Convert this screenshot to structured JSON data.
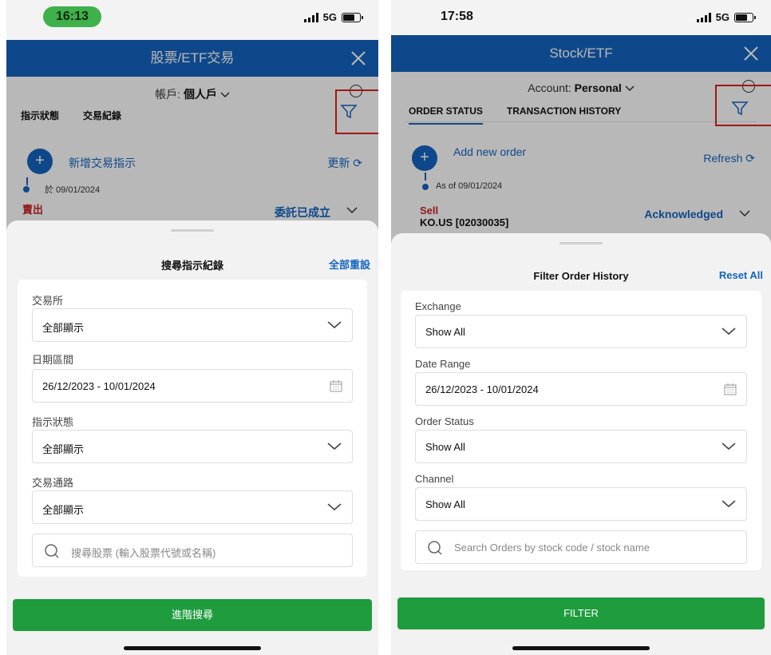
{
  "screens": [
    {
      "status": {
        "time": "16:13",
        "network": "5G"
      },
      "header": {
        "title": "股票/ETF交易"
      },
      "account": {
        "label": "帳戶:",
        "value": "個人戶"
      },
      "tabs": [
        "指示狀態",
        "交易紀錄"
      ],
      "actions": {
        "add": "新增交易指示",
        "refresh": "更新"
      },
      "as_of": "於 09/01/2024",
      "order": {
        "type": "賣出",
        "code": "",
        "status": "委託已成立"
      },
      "sheet": {
        "title": "搜尋指示紀錄",
        "reset": "全部重設",
        "fields": [
          {
            "label": "交易所",
            "value": "全部顯示",
            "kind": "select"
          },
          {
            "label": "日期區間",
            "value": "26/12/2023 - 10/01/2024",
            "kind": "date"
          },
          {
            "label": "指示狀態",
            "value": "全部顯示",
            "kind": "select"
          },
          {
            "label": "交易通路",
            "value": "全部顯示",
            "kind": "select"
          }
        ],
        "search_placeholder": "搜尋股票 (輸入股票代號或名稱)",
        "submit": "進階搜尋"
      }
    },
    {
      "status": {
        "time": "17:58",
        "network": "5G"
      },
      "header": {
        "title": "Stock/ETF"
      },
      "account": {
        "label": "Account:",
        "value": "Personal"
      },
      "tabs": [
        "ORDER STATUS",
        "TRANSACTION HISTORY"
      ],
      "actions": {
        "add": "Add new order",
        "refresh": "Refresh"
      },
      "as_of": "As of 09/01/2024",
      "order": {
        "type": "Sell",
        "code": "KO.US [02030035]",
        "status": "Acknowledged"
      },
      "sheet": {
        "title": "Filter Order History",
        "reset": "Reset All",
        "fields": [
          {
            "label": "Exchange",
            "value": "Show All",
            "kind": "select"
          },
          {
            "label": "Date Range",
            "value": "26/12/2023 - 10/01/2024",
            "kind": "date"
          },
          {
            "label": "Order Status",
            "value": "Show All",
            "kind": "select"
          },
          {
            "label": "Channel",
            "value": "Show All",
            "kind": "select"
          }
        ],
        "search_placeholder": "Search Orders by stock code / stock name",
        "submit": "FILTER"
      }
    }
  ],
  "colors": {
    "brand_blue": "#1565c0",
    "button_green": "#1f9c3e",
    "highlight_red": "#e02020",
    "sell_red": "#c62828"
  },
  "icons": [
    "close-icon",
    "search-icon",
    "filter-icon",
    "plus-icon",
    "refresh-icon",
    "chevron-down-icon",
    "calendar-icon",
    "signal-icon",
    "battery-icon"
  ]
}
